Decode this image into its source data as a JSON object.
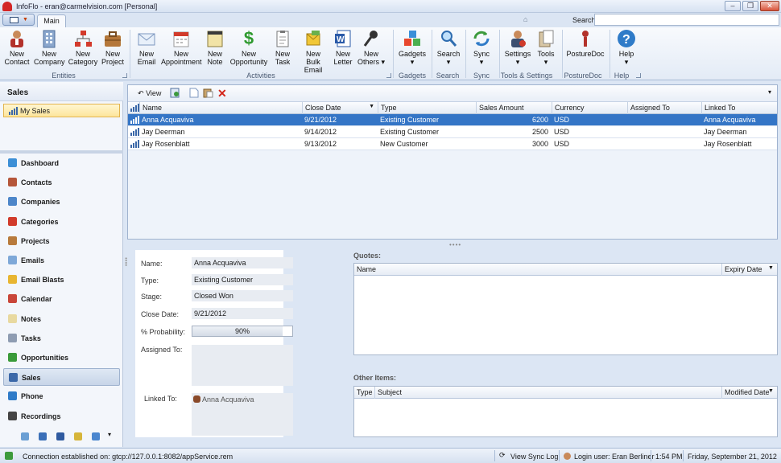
{
  "window": {
    "title": "InfoFlo - eran@carmelvision.com [Personal]"
  },
  "tabs": {
    "main": "Main"
  },
  "search": {
    "label": "Search",
    "value": ""
  },
  "ribbon": {
    "buttons": {
      "new_contact": [
        "New",
        "Contact"
      ],
      "new_company": [
        "New",
        "Company"
      ],
      "new_category": [
        "New",
        "Category"
      ],
      "new_project": [
        "New",
        "Project"
      ],
      "new_email": [
        "New",
        "Email"
      ],
      "new_appointment": [
        "New",
        "Appointment"
      ],
      "new_note": [
        "New",
        "Note"
      ],
      "new_opportunity": [
        "New",
        "Opportunity"
      ],
      "new_task": [
        "New",
        "Task"
      ],
      "new_bulk_email": [
        "New",
        "Bulk Email"
      ],
      "new_letter": [
        "New",
        "Letter"
      ],
      "new_others": [
        "New",
        "Others ▾"
      ],
      "gadgets": "Gadgets",
      "search": "Search",
      "sync": "Sync",
      "settings": "Settings",
      "tools": "Tools",
      "posturedoc": "PostureDoc",
      "help": "Help"
    },
    "groups": {
      "entities": "Entities",
      "activities": "Activities",
      "gadgets": "Gadgets",
      "search": "Search",
      "sync": "Sync",
      "tools_settings": "Tools & Settings",
      "posturedoc": "PostureDoc",
      "help": "Help"
    }
  },
  "sidebar": {
    "header": "Sales",
    "my_sales": "My Sales",
    "nav": [
      {
        "label": "Dashboard",
        "color": "#3c8fd6"
      },
      {
        "label": "Contacts",
        "color": "#b5563a"
      },
      {
        "label": "Companies",
        "color": "#4d86c9"
      },
      {
        "label": "Categories",
        "color": "#d13b2b"
      },
      {
        "label": "Projects",
        "color": "#b87a3c"
      },
      {
        "label": "Emails",
        "color": "#7ea8d8"
      },
      {
        "label": "Email Blasts",
        "color": "#e8b531"
      },
      {
        "label": "Calendar",
        "color": "#c9463a"
      },
      {
        "label": "Notes",
        "color": "#e8d9a0"
      },
      {
        "label": "Tasks",
        "color": "#8e9cb2"
      },
      {
        "label": "Opportunities",
        "color": "#3a9a3a"
      },
      {
        "label": "Sales",
        "color": "#3b68a8"
      },
      {
        "label": "Phone",
        "color": "#2f7bc8"
      },
      {
        "label": "Recordings",
        "color": "#444444"
      }
    ]
  },
  "grid": {
    "toolbar": {
      "view": "View"
    },
    "columns": [
      "Name",
      "Close Date",
      "Type",
      "Sales Amount",
      "Currency",
      "Assigned To",
      "Linked To"
    ],
    "rows": [
      {
        "name": "Anna Acquaviva",
        "close_date": "9/21/2012",
        "type": "Existing Customer",
        "amount": "6200",
        "currency": "USD",
        "assigned": "",
        "linked": "Anna Acquaviva"
      },
      {
        "name": "Jay Deerman",
        "close_date": "9/14/2012",
        "type": "Existing Customer",
        "amount": "2500",
        "currency": "USD",
        "assigned": "",
        "linked": "Jay Deerman"
      },
      {
        "name": "Jay Rosenblatt",
        "close_date": "9/13/2012",
        "type": "New Customer",
        "amount": "3000",
        "currency": "USD",
        "assigned": "",
        "linked": "Jay Rosenblatt"
      }
    ]
  },
  "detail": {
    "name_label": "Name:",
    "name": "Anna Acquaviva",
    "type_label": "Type:",
    "type": "Existing Customer",
    "stage_label": "Stage:",
    "stage": "Closed Won",
    "close_label": "Close Date:",
    "close_date": "9/21/2012",
    "prob_label": "% Probability:",
    "probability": "90%",
    "probability_value": 0.9,
    "assigned_label": "Assigned To:",
    "linked_label": "Linked To:",
    "linked": "Anna Acquaviva"
  },
  "quotes": {
    "label": "Quotes:",
    "col_name": "Name",
    "col_expiry": "Expiry Date"
  },
  "other": {
    "label": "Other Items:",
    "col_type": "Type",
    "col_subject": "Subject",
    "col_modified": "Modified Date"
  },
  "status": {
    "connection": "Connection established on: gtcp://127.0.0.1:8082/appService.rem",
    "sync_log": "View Sync Log",
    "login": "Login user: Eran Berliner",
    "time": "1:54 PM",
    "date": "Friday, September 21, 2012"
  }
}
